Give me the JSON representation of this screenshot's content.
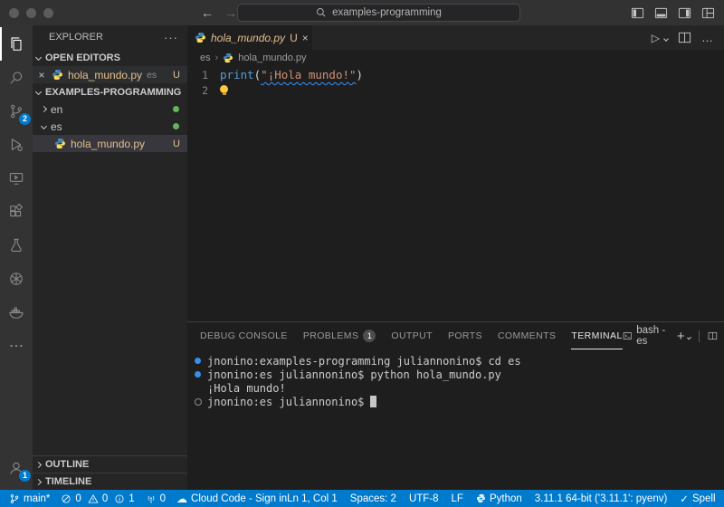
{
  "icons": {
    "close": "×",
    "ellipsis": "…",
    "more": "···",
    "run": "▷",
    "back": "←",
    "forward": "→",
    "cloud": "☁",
    "check": "✓",
    "breadcrumb_sep": "›",
    "plus": "+"
  },
  "titlebar": {
    "search_text": "examples-programming"
  },
  "activity_bar": {
    "scm_badge": "2",
    "account_badge": "1"
  },
  "sidebar": {
    "title": "EXPLORER",
    "open_editors_label": "OPEN EDITORS",
    "open_editor": {
      "file": "hola_mundo.py",
      "folder": "es",
      "git": "U"
    },
    "root_label": "EXAMPLES-PROGRAMMING",
    "folder_en": "en",
    "folder_es": "es",
    "file": {
      "name": "hola_mundo.py",
      "git": "U"
    },
    "outline_label": "OUTLINE",
    "timeline_label": "TIMELINE"
  },
  "editor": {
    "tab": {
      "name": "hola_mundo.py",
      "git": "U"
    },
    "breadcrumb_folder": "es",
    "breadcrumb_file": "hola_mundo.py",
    "lines": {
      "1": {
        "num": "1",
        "func": "print",
        "open": "(",
        "string": "\"¡Hola mundo!\"",
        "close": ")"
      },
      "2": {
        "num": "2"
      }
    }
  },
  "panel": {
    "tabs": [
      "DEBUG CONSOLE",
      "PROBLEMS",
      "OUTPUT",
      "PORTS",
      "COMMENTS",
      "TERMINAL"
    ],
    "problems_badge": "1",
    "shell_label": "bash - es",
    "terminal": [
      {
        "prompt": "jnonino:examples-programming juliannonino$",
        "cmd": "cd es"
      },
      {
        "prompt": "jnonino:es juliannonino$",
        "cmd": "python hola_mundo.py"
      },
      {
        "output": "¡Hola mundo!"
      },
      {
        "prompt": "jnonino:es juliannonino$",
        "cmd": ""
      }
    ]
  },
  "statusbar": {
    "branch": "main*",
    "errors": "0",
    "warnings": "0",
    "infos": "1",
    "ports": "0",
    "cloud": "Cloud Code - Sign in",
    "cursor": "Ln 1, Col 1",
    "indent": "Spaces: 2",
    "encoding": "UTF-8",
    "eol": "LF",
    "language": "Python",
    "interpreter": "3.11.1 64-bit ('3.11.1': pyenv)",
    "spell": "Spell"
  }
}
